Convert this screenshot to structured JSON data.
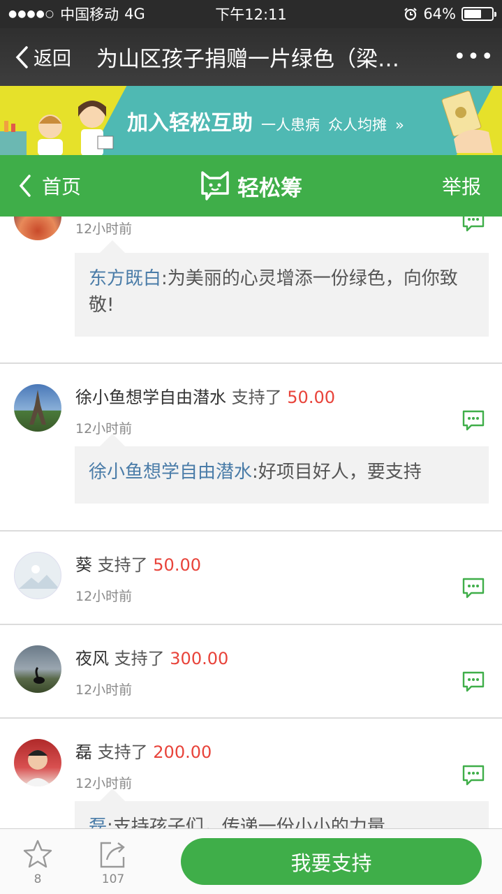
{
  "status_bar": {
    "carrier": "中国移动",
    "network": "4G",
    "time": "下午12:11",
    "battery": "64%",
    "battery_level": 0.64
  },
  "nav": {
    "back_label": "返回",
    "title": "为山区孩子捐赠一片绿色（梁…",
    "more_label": "•••"
  },
  "banner": {
    "main_text": "加入轻松互助",
    "sub_text_1": "一人患病",
    "sub_text_2": "众人均摊",
    "chevron": "»"
  },
  "header": {
    "home_label": "首页",
    "brand": "轻松筹",
    "report_label": "举报"
  },
  "feed": [
    {
      "name": "",
      "verb": "",
      "amount": "",
      "time": "12小时前",
      "comment_author": "东方既白",
      "comment_text": "为美丽的心灵增添一份绿色，向你致敬!"
    },
    {
      "name": "徐小鱼想学自由潜水",
      "verb": "支持了",
      "amount": "50.00",
      "time": "12小时前",
      "comment_author": "徐小鱼想学自由潜水",
      "comment_text": "好项目好人，要支持"
    },
    {
      "name": "葵",
      "verb": "支持了",
      "amount": "50.00",
      "time": "12小时前"
    },
    {
      "name": "夜风",
      "verb": "支持了",
      "amount": "300.00",
      "time": "12小时前"
    },
    {
      "name": "磊",
      "verb": "支持了",
      "amount": "200.00",
      "time": "12小时前",
      "comment_author": "磊",
      "comment_text": "支持孩子们，传递一份小小的力量"
    }
  ],
  "bottom_bar": {
    "favorites_count": "8",
    "share_count": "107",
    "support_label": "我要支持"
  },
  "colors": {
    "green": "#3fae49",
    "amount_red": "#e8433a",
    "name_blue": "#4a7ca8"
  }
}
